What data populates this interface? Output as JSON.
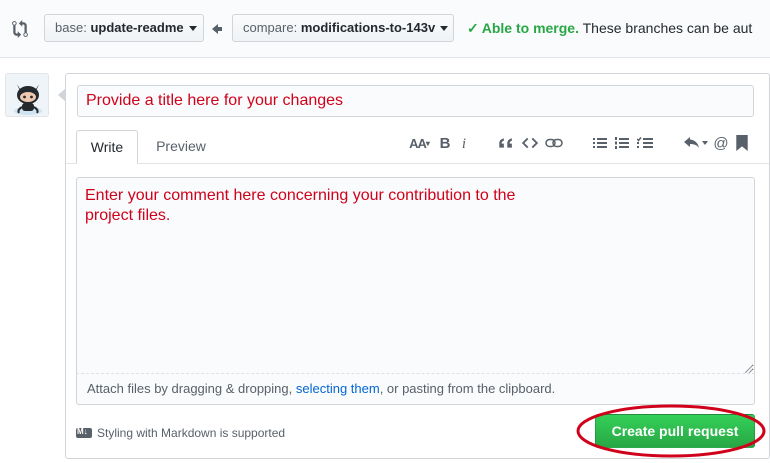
{
  "compare_bar": {
    "base_label": "base:",
    "base_branch": "update-readme",
    "compare_label": "compare:",
    "compare_branch": "modifications-to-143v",
    "merge_ok": "Able to merge.",
    "merge_text": "These branches can be aut"
  },
  "form": {
    "title_placeholder": "Provide a title here for your changes",
    "tabs": [
      {
        "label": "Write",
        "selected": true
      },
      {
        "label": "Preview",
        "selected": false
      }
    ],
    "toolbar": {
      "header_text": "AA",
      "bold_text": "B",
      "italic_text": "i",
      "mention_text": "@"
    },
    "comment_placeholder": "Enter your comment here concerning your contribution to the\nproject files.",
    "attach_before": "Attach files by dragging & dropping, ",
    "attach_link": "selecting them",
    "attach_after": ", or pasting from the clipboard.",
    "markdown_note": "Styling with Markdown is supported",
    "submit_label": "Create pull request"
  },
  "icons": {
    "compare": "git-compare-icon",
    "arrow": "arrow-left-icon",
    "check": "check-icon",
    "avatar": "octocat-avatar",
    "markdown": "markdown-icon"
  },
  "colors": {
    "success": "#28a745",
    "annotation_red": "#d0021b",
    "link": "#0366d6"
  }
}
